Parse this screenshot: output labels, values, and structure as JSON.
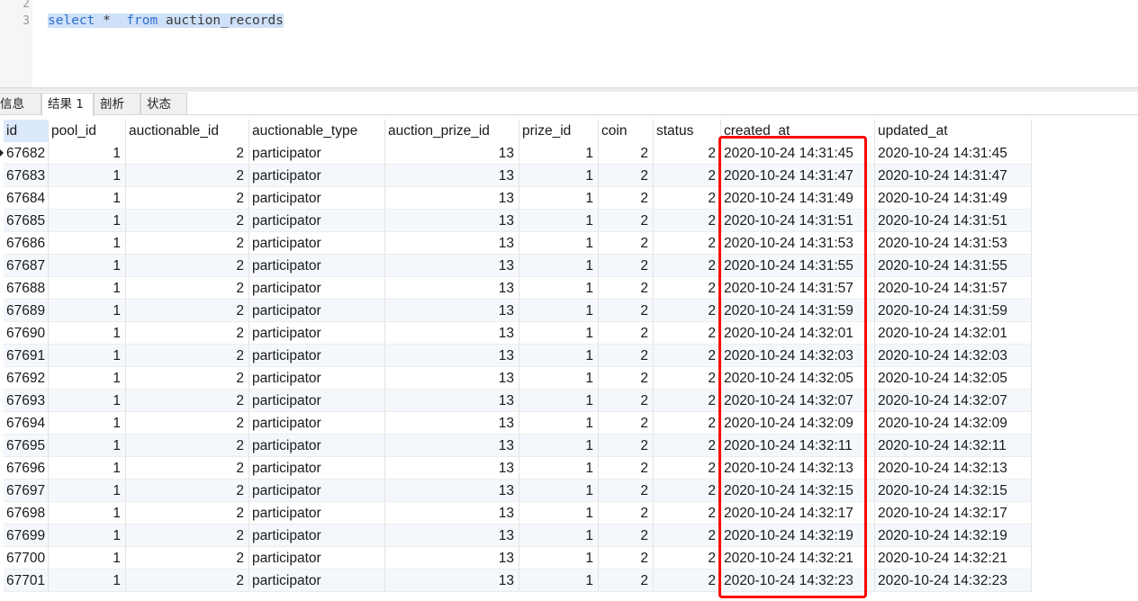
{
  "editor": {
    "line_numbers": [
      "2",
      "3"
    ],
    "query_keyword_select": "select",
    "query_star": " *  ",
    "query_keyword_from": "from",
    "query_table": " auction_records"
  },
  "tabs": [
    {
      "label": "信息",
      "active": false
    },
    {
      "label": "结果 1",
      "active": true
    },
    {
      "label": "剖析",
      "active": false
    },
    {
      "label": "状态",
      "active": false
    }
  ],
  "columns": [
    "id",
    "pool_id",
    "auctionable_id",
    "auctionable_type",
    "auction_prize_id",
    "prize_id",
    "coin",
    "status",
    "created_at",
    "updated_at"
  ],
  "rows": [
    [
      "67682",
      "1",
      "2",
      "participator",
      "13",
      "1",
      "2",
      "2",
      "2020-10-24 14:31:45",
      "2020-10-24 14:31:45"
    ],
    [
      "67683",
      "1",
      "2",
      "participator",
      "13",
      "1",
      "2",
      "2",
      "2020-10-24 14:31:47",
      "2020-10-24 14:31:47"
    ],
    [
      "67684",
      "1",
      "2",
      "participator",
      "13",
      "1",
      "2",
      "2",
      "2020-10-24 14:31:49",
      "2020-10-24 14:31:49"
    ],
    [
      "67685",
      "1",
      "2",
      "participator",
      "13",
      "1",
      "2",
      "2",
      "2020-10-24 14:31:51",
      "2020-10-24 14:31:51"
    ],
    [
      "67686",
      "1",
      "2",
      "participator",
      "13",
      "1",
      "2",
      "2",
      "2020-10-24 14:31:53",
      "2020-10-24 14:31:53"
    ],
    [
      "67687",
      "1",
      "2",
      "participator",
      "13",
      "1",
      "2",
      "2",
      "2020-10-24 14:31:55",
      "2020-10-24 14:31:55"
    ],
    [
      "67688",
      "1",
      "2",
      "participator",
      "13",
      "1",
      "2",
      "2",
      "2020-10-24 14:31:57",
      "2020-10-24 14:31:57"
    ],
    [
      "67689",
      "1",
      "2",
      "participator",
      "13",
      "1",
      "2",
      "2",
      "2020-10-24 14:31:59",
      "2020-10-24 14:31:59"
    ],
    [
      "67690",
      "1",
      "2",
      "participator",
      "13",
      "1",
      "2",
      "2",
      "2020-10-24 14:32:01",
      "2020-10-24 14:32:01"
    ],
    [
      "67691",
      "1",
      "2",
      "participator",
      "13",
      "1",
      "2",
      "2",
      "2020-10-24 14:32:03",
      "2020-10-24 14:32:03"
    ],
    [
      "67692",
      "1",
      "2",
      "participator",
      "13",
      "1",
      "2",
      "2",
      "2020-10-24 14:32:05",
      "2020-10-24 14:32:05"
    ],
    [
      "67693",
      "1",
      "2",
      "participator",
      "13",
      "1",
      "2",
      "2",
      "2020-10-24 14:32:07",
      "2020-10-24 14:32:07"
    ],
    [
      "67694",
      "1",
      "2",
      "participator",
      "13",
      "1",
      "2",
      "2",
      "2020-10-24 14:32:09",
      "2020-10-24 14:32:09"
    ],
    [
      "67695",
      "1",
      "2",
      "participator",
      "13",
      "1",
      "2",
      "2",
      "2020-10-24 14:32:11",
      "2020-10-24 14:32:11"
    ],
    [
      "67696",
      "1",
      "2",
      "participator",
      "13",
      "1",
      "2",
      "2",
      "2020-10-24 14:32:13",
      "2020-10-24 14:32:13"
    ],
    [
      "67697",
      "1",
      "2",
      "participator",
      "13",
      "1",
      "2",
      "2",
      "2020-10-24 14:32:15",
      "2020-10-24 14:32:15"
    ],
    [
      "67698",
      "1",
      "2",
      "participator",
      "13",
      "1",
      "2",
      "2",
      "2020-10-24 14:32:17",
      "2020-10-24 14:32:17"
    ],
    [
      "67699",
      "1",
      "2",
      "participator",
      "13",
      "1",
      "2",
      "2",
      "2020-10-24 14:32:19",
      "2020-10-24 14:32:19"
    ],
    [
      "67700",
      "1",
      "2",
      "participator",
      "13",
      "1",
      "2",
      "2",
      "2020-10-24 14:32:21",
      "2020-10-24 14:32:21"
    ],
    [
      "67701",
      "1",
      "2",
      "participator",
      "13",
      "1",
      "2",
      "2",
      "2020-10-24 14:32:23",
      "2020-10-24 14:32:23"
    ]
  ],
  "colors": {
    "keyword": "#2f6fd1",
    "selection": "#cfe1f9",
    "highlight_box": "#ff0000"
  },
  "icons": {
    "current_row_marker": "current-row-marker-icon"
  }
}
